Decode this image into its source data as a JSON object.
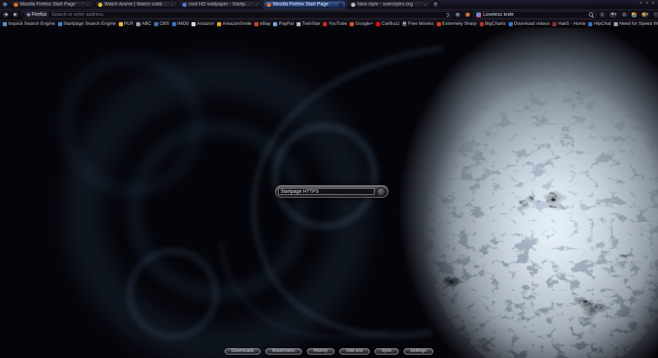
{
  "tab_bar": {
    "tabs": [
      {
        "label": "Mozilla Firefox Start Page",
        "icon": "firefox-icon",
        "icon_color": "#e07020",
        "active": false
      },
      {
        "label": "Watch Anime | Watch subbed/dub...",
        "icon": "watch-anime-site-icon",
        "icon_color": "#e8c227",
        "active": false
      },
      {
        "label": "cool HD wallpaper - Startpage Pictu...",
        "icon": "startpage-icon",
        "icon_color": "#4a7fd4",
        "active": false
      },
      {
        "label": "Mozilla Firefox Start Page",
        "icon": "firefox-icon",
        "icon_color": "#e07020",
        "active": true
      },
      {
        "label": "New style - userstyles.org",
        "icon": "userstyles-icon",
        "icon_color": "#b9bcc4",
        "active": false
      }
    ],
    "new_tab_glyph": "+"
  },
  "navigation": {
    "back_glyph": "◄",
    "forward_glyph": "►",
    "url_bar": {
      "site_button_label": "Firefox",
      "placeholder": "Search or enter address"
    },
    "search_bar": {
      "value": "Loveless knife"
    },
    "downloads_glyph": "↓",
    "bookmarks_star_glyph": "★",
    "dropdown_caret_glyph": "▾",
    "home_glyph": "⌂"
  },
  "bookmarks_bar": {
    "items": [
      {
        "label": "Ixquick Search Engine",
        "icon": "ixquick-icon",
        "color": "#5a8fd6"
      },
      {
        "label": "Startpage Search Engine",
        "icon": "startpage-icon",
        "color": "#4a7fd4"
      },
      {
        "label": "PLR",
        "icon": "plr-icon",
        "color": "#e8c227"
      },
      {
        "label": "ABC",
        "icon": "abc-icon",
        "color": "#9aa0a8"
      },
      {
        "label": "CBS",
        "icon": "cbs-icon",
        "color": "#4a6fb0"
      },
      {
        "label": "IMDb",
        "icon": "imdb-icon",
        "color": "#3d6dbf"
      },
      {
        "label": "Amazon",
        "icon": "amazon-icon",
        "color": "#d8d8d8"
      },
      {
        "label": "AmazonSmile",
        "icon": "amazonsmile-icon",
        "color": "#e89a2f"
      },
      {
        "label": "eBay",
        "icon": "ebay-icon",
        "color": "#cc4433"
      },
      {
        "label": "PayPal",
        "icon": "paypal-icon",
        "color": "#7a9fd4"
      },
      {
        "label": "TwinStar",
        "icon": "twinstar-icon",
        "color": "#b0b4bc"
      },
      {
        "label": "YouTube",
        "icon": "youtube-icon",
        "color": "#cc2222"
      },
      {
        "label": "Google+",
        "icon": "googleplus-icon",
        "color": "#dd4b39"
      },
      {
        "label": "CarBuzz",
        "icon": "carbuzz-icon",
        "color": "#e01010"
      },
      {
        "label": "Free Movies",
        "icon": "free-movies-icon",
        "color": "#555a62",
        "glyph": "M"
      },
      {
        "label": "Extremely Sharp",
        "icon": "extremely-sharp-icon",
        "color": "#d43a1a"
      },
      {
        "label": "BigCharts",
        "icon": "bigcharts-icon",
        "color": "#b03030"
      },
      {
        "label": "Download videos",
        "icon": "download-videos-icon",
        "color": "#3a6fd0"
      },
      {
        "label": "Hak5 - Home",
        "icon": "hak5-icon",
        "color": "#8a3030"
      },
      {
        "label": "HipChat",
        "icon": "hipchat-icon",
        "color": "#3a6fd0"
      },
      {
        "label": "Need for Speed World",
        "icon": "nfs-world-icon",
        "color": "#9aa0a8"
      }
    ]
  },
  "content": {
    "search_widget": {
      "value": "Startpage HTTPS"
    },
    "buttons": [
      {
        "label": "Downloads"
      },
      {
        "label": "Bookmarks"
      },
      {
        "label": "History"
      },
      {
        "label": "Add-ons"
      },
      {
        "label": "Sync"
      },
      {
        "label": "Settings"
      }
    ]
  },
  "colors": {
    "active_tab_accent": "#3d5d9f",
    "wallpaper_blue": "#6f94b8",
    "background": "#04050a"
  }
}
